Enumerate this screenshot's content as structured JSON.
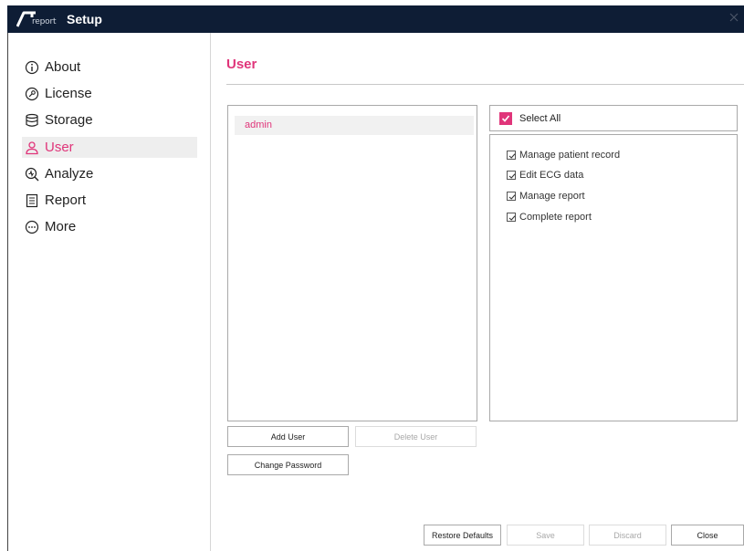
{
  "window": {
    "logo_subtext": "report",
    "title": "Setup"
  },
  "sidebar": {
    "items": [
      {
        "label": "About",
        "icon": "info-circle-icon"
      },
      {
        "label": "License",
        "icon": "key-circle-icon"
      },
      {
        "label": "Storage",
        "icon": "database-icon"
      },
      {
        "label": "User",
        "icon": "user-icon",
        "active": true
      },
      {
        "label": "Analyze",
        "icon": "magnify-plus-icon"
      },
      {
        "label": "Report",
        "icon": "report-doc-icon"
      },
      {
        "label": "More",
        "icon": "more-dots-icon"
      }
    ]
  },
  "main": {
    "title": "User",
    "users": [
      "admin"
    ],
    "select_all_label": "Select All",
    "permissions": [
      "Manage patient record",
      "Edit ECG data",
      "Manage report",
      "Complete report"
    ],
    "buttons": {
      "add_user": "Add User",
      "delete_user": "Delete User",
      "change_password": "Change Password"
    }
  },
  "footer": {
    "restore_defaults": "Restore Defaults",
    "save": "Save",
    "discard": "Discard",
    "close": "Close"
  },
  "colors": {
    "accent": "#e0357a",
    "titlebar": "#0e1d35"
  }
}
